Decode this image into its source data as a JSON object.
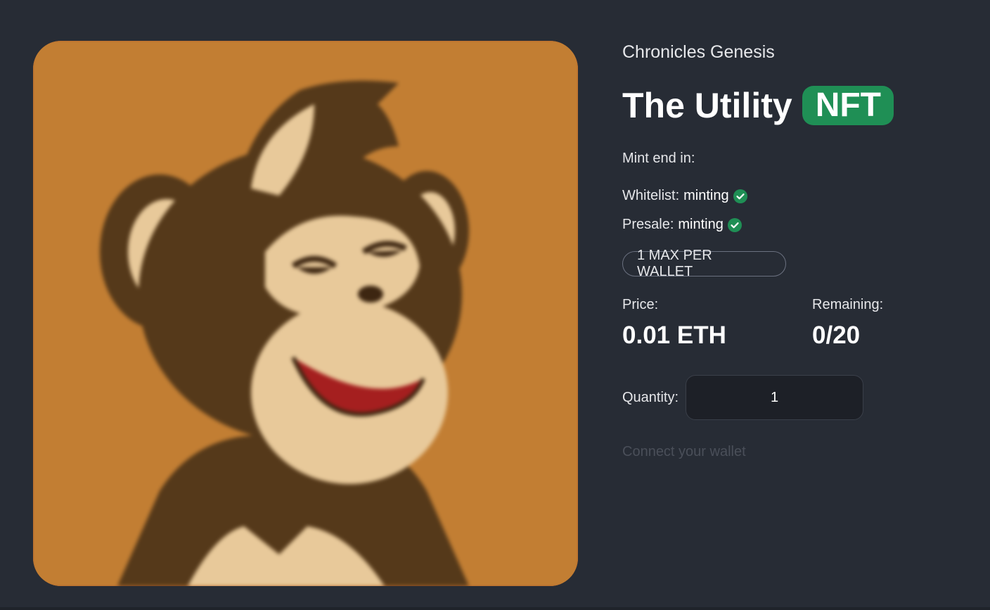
{
  "collection": {
    "name": "Chronicles Genesis"
  },
  "title": {
    "main": "The Utility",
    "badge": "NFT"
  },
  "mint": {
    "end_label": "Mint end in:",
    "phases": [
      {
        "label": "Whitelist:",
        "status": "minting",
        "icon": "check-circle-icon"
      },
      {
        "label": "Presale:",
        "status": "minting",
        "icon": "check-circle-icon"
      }
    ],
    "limit": "1 MAX PER WALLET"
  },
  "stats": {
    "price_label": "Price:",
    "price_value": "0.01 ETH",
    "remaining_label": "Remaining:",
    "remaining_value": "0/20"
  },
  "quantity": {
    "label": "Quantity:",
    "value": "1"
  },
  "wallet": {
    "connect_label": "Connect your wallet"
  },
  "colors": {
    "background": "#272c35",
    "badge": "#1f8f55",
    "image_background": "#c27e33"
  }
}
